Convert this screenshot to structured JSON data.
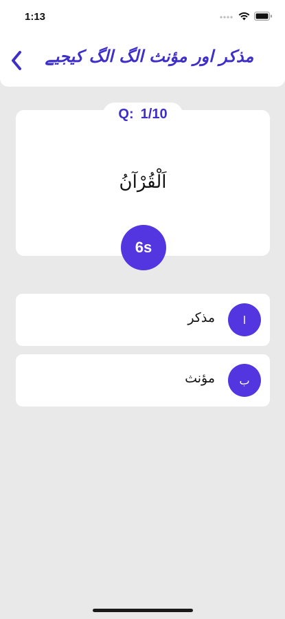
{
  "status_bar": {
    "time": "1:13",
    "icons": [
      "signal-dots-icon",
      "wifi-icon",
      "battery-icon"
    ]
  },
  "header": {
    "title": "مذکر اور مؤنث الگ الگ کیجیے",
    "back_icon": "chevron-left-icon"
  },
  "question": {
    "label": "Q:",
    "progress": "1/10",
    "word": "اَلْقُرْآنُ",
    "timer": "6s"
  },
  "options": [
    {
      "letter": "ا",
      "text": "مذکر"
    },
    {
      "letter": "ب",
      "text": "مؤنث"
    }
  ],
  "colors": {
    "accent": "#5336e0",
    "title": "#3d2fc7",
    "background": "#e9e9e9"
  }
}
